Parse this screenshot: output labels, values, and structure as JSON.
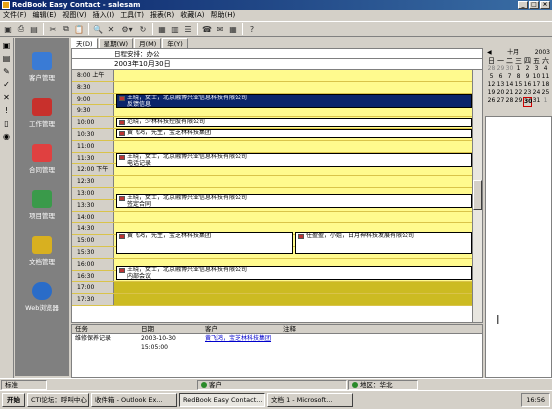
{
  "window": {
    "title": "RedBook Easy Contact - salesam"
  },
  "menu": [
    "文件(F)",
    "编辑(E)",
    "视图(V)",
    "插入(I)",
    "工具(T)",
    "报表(R)",
    "收藏(A)",
    "帮助(H)"
  ],
  "sidebar": {
    "items": [
      {
        "label": "客户管理"
      },
      {
        "label": "工作管理"
      },
      {
        "label": "合同管理"
      },
      {
        "label": "项目管理"
      },
      {
        "label": "文档管理"
      },
      {
        "label": "Web浏览器"
      }
    ]
  },
  "view_tabs": [
    "天(D)",
    "星期(W)",
    "月(M)",
    "年(Y)"
  ],
  "schedule": {
    "header": "日程安排：办公",
    "date": "2003年10月30日",
    "times": [
      "8:00 上午",
      "8:30",
      "9:00",
      "9:30",
      "10:00",
      "10:30",
      "11:00",
      "11:30",
      "12:00 下午",
      "12:30",
      "13:00",
      "13:30",
      "14:00",
      "14:30",
      "15:00",
      "15:30",
      "16:00",
      "16:30",
      "17:00",
      "17:30"
    ],
    "events": [
      {
        "line1": "王晓，女士，北京融博兴业信息科技有限公司",
        "line2": "反馈信息"
      },
      {
        "line1": "范晓，少林科技控股有限公司",
        "line2": ""
      },
      {
        "line1": "黄飞鸿，先生，宝芝林科技集团",
        "line2": ""
      },
      {
        "line1": "王晓，女士，北京融博兴业信息科技有限公司",
        "line2": "电话记录"
      },
      {
        "line1": "王晓，女士，北京融博兴业信息科技有限公司",
        "line2": "签定合同"
      },
      {
        "line1": "黄飞鸿，先生，宝芝林科技集团",
        "line2": ""
      },
      {
        "line1": "任盈盈，小姐，日月神科技发展有限公司",
        "line2": ""
      },
      {
        "line1": "王晓，女士，北京融博兴业信息科技有限公司",
        "line2": "内部会议"
      }
    ]
  },
  "tasks": {
    "columns": [
      "任务",
      "日期",
      "客户",
      "注释"
    ],
    "rows": [
      {
        "task": "维修保养记录",
        "date": "2003-10-30 15:05:00",
        "customer": "黄飞鸿，宝芝林科技集团",
        "note": ""
      }
    ]
  },
  "calendar": {
    "month": "十月",
    "year": "2003",
    "weekdays": [
      "日",
      "一",
      "二",
      "三",
      "四",
      "五",
      "六"
    ],
    "days": [
      "28",
      "29",
      "30",
      "1",
      "2",
      "3",
      "4",
      "5",
      "6",
      "7",
      "8",
      "9",
      "10",
      "11",
      "12",
      "13",
      "14",
      "15",
      "16",
      "17",
      "18",
      "19",
      "20",
      "21",
      "22",
      "23",
      "24",
      "25",
      "26",
      "27",
      "28",
      "29",
      "30",
      "31",
      "1"
    ],
    "today": "30"
  },
  "statusbar": {
    "bottom_tab": "标准",
    "customer": "客户",
    "region": "地区：华北"
  },
  "taskbar": {
    "start": "开始",
    "tasks": [
      "CTI论坛：呼叫中心 - ...",
      "收件箱 - Outlook Ex...",
      "RedBook Easy Contact...",
      "文档 1 - Microsoft..."
    ],
    "clock": "16:56"
  }
}
